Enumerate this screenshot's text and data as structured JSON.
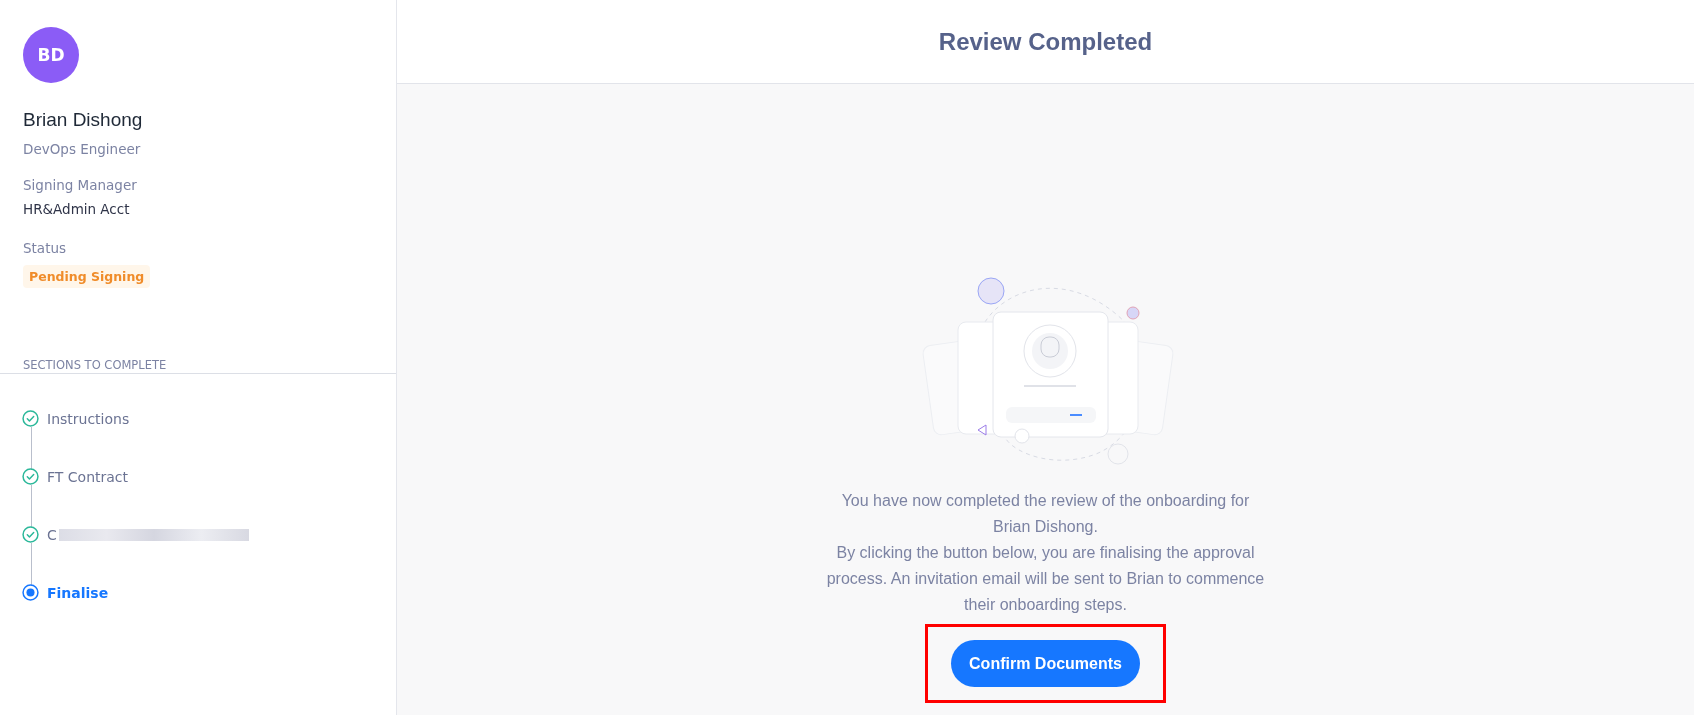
{
  "profile": {
    "initials": "BD",
    "name": "Brian Dishong",
    "role": "DevOps Engineer",
    "manager_label": "Signing Manager",
    "manager": "HR&Admin Acct",
    "status_label": "Status",
    "status": "Pending Signing"
  },
  "sections": {
    "heading": "SECTIONS TO COMPLETE",
    "steps": [
      {
        "label": "Instructions",
        "completed": true,
        "selected": false,
        "redacted": false
      },
      {
        "label": "FT Contract",
        "completed": true,
        "selected": false,
        "redacted": false
      },
      {
        "label": "C",
        "completed": true,
        "selected": false,
        "redacted": true
      },
      {
        "label": "Finalise",
        "completed": false,
        "selected": true,
        "redacted": false
      }
    ]
  },
  "header": {
    "title": "Review Completed"
  },
  "message": [
    "You have now completed the review of the onboarding for Brian Dishong.",
    "By clicking the button below, you are finalising the approval process. An invitation email will be sent to Brian to commence their onboarding steps."
  ],
  "confirm_button": {
    "label": "Confirm Documents",
    "highlighted": true
  }
}
